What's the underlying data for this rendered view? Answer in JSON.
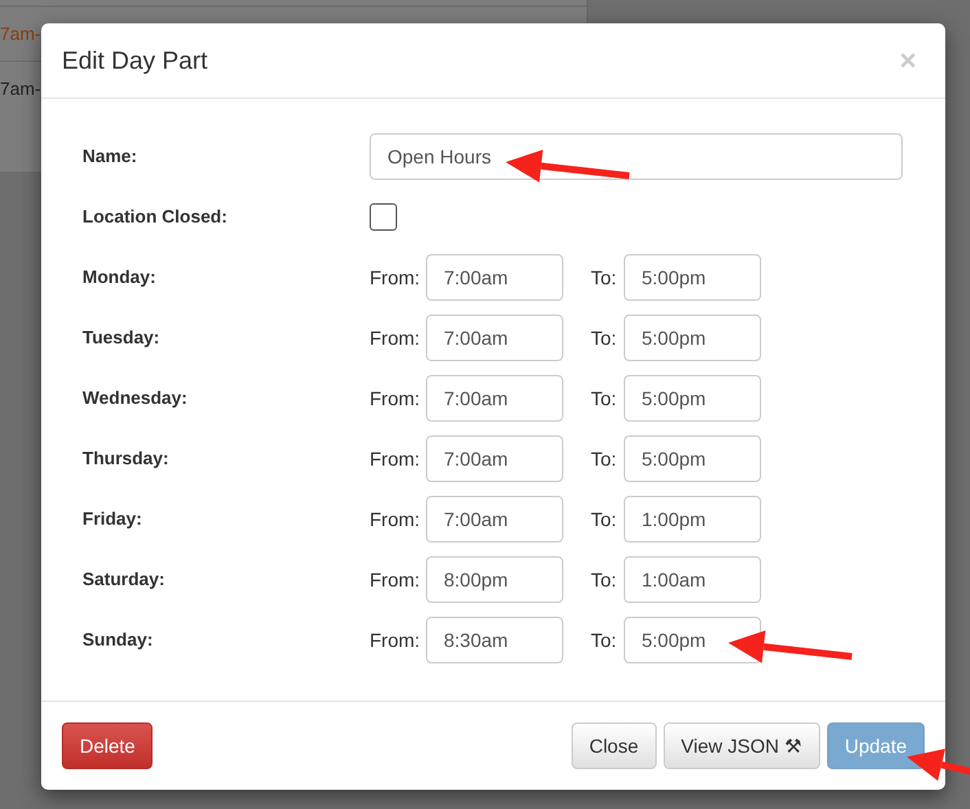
{
  "background": {
    "rows": [
      {
        "text": "7am-",
        "kind": "link"
      },
      {
        "text": "7am-",
        "kind": "plain"
      }
    ]
  },
  "dialog": {
    "title": "Edit Day Part",
    "close": "×",
    "name": {
      "label": "Name:",
      "value": "Open Hours"
    },
    "closed": {
      "label": "Location Closed:",
      "checked": false
    },
    "days": [
      {
        "day": "Monday:",
        "from_label": "From:",
        "from": "7:00am",
        "to_label": "To:",
        "to": "5:00pm"
      },
      {
        "day": "Tuesday:",
        "from_label": "From:",
        "from": "7:00am",
        "to_label": "To:",
        "to": "5:00pm"
      },
      {
        "day": "Wednesday:",
        "from_label": "From:",
        "from": "7:00am",
        "to_label": "To:",
        "to": "5:00pm"
      },
      {
        "day": "Thursday:",
        "from_label": "From:",
        "from": "7:00am",
        "to_label": "To:",
        "to": "5:00pm"
      },
      {
        "day": "Friday:",
        "from_label": "From:",
        "from": "7:00am",
        "to_label": "To:",
        "to": "1:00pm"
      },
      {
        "day": "Saturday:",
        "from_label": "From:",
        "from": "8:00pm",
        "to_label": "To:",
        "to": "1:00am"
      },
      {
        "day": "Sunday:",
        "from_label": "From:",
        "from": "8:30am",
        "to_label": "To:",
        "to": "5:00pm"
      }
    ],
    "buttons": [
      {
        "label": "Delete",
        "kind": "danger",
        "disabled": false
      },
      {
        "label": "Close",
        "kind": "default",
        "disabled": false
      },
      {
        "label": "View JSON ⚒",
        "kind": "default",
        "disabled": false
      },
      {
        "label": "Update",
        "kind": "primary",
        "disabled": true
      }
    ]
  }
}
